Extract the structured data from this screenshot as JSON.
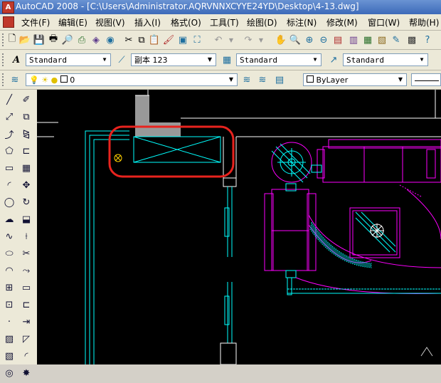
{
  "app": {
    "icon_letter": "A",
    "title": "AutoCAD 2008 - [C:\\Users\\Administrator.AQRVNNXCYYE24YD\\Desktop\\4-13.dwg]"
  },
  "menu": [
    "文件(F)",
    "编辑(E)",
    "视图(V)",
    "插入(I)",
    "格式(O)",
    "工具(T)",
    "绘图(D)",
    "标注(N)",
    "修改(M)",
    "窗口(W)",
    "帮助(H)"
  ],
  "styles": {
    "text_style": "Standard",
    "dim_style": "副本 123",
    "table_style": "Standard",
    "multileader_style": "Standard"
  },
  "layers": {
    "current_layer": "0",
    "color": "ByLayer"
  },
  "colors": {
    "canvas": "#000000",
    "cyan": "#00ffff",
    "magenta": "#ff00ff",
    "white": "#ffffff",
    "highlight": "#e8231e"
  }
}
